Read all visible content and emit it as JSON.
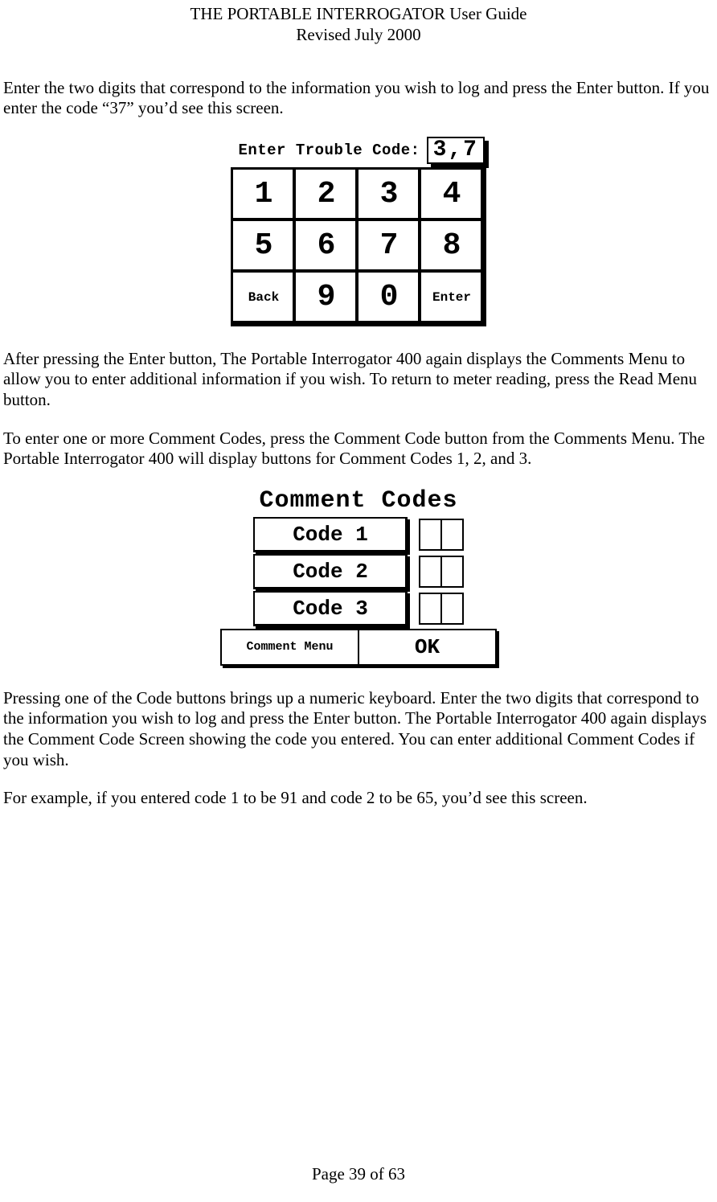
{
  "header": {
    "title": "THE PORTABLE INTERROGATOR User Guide",
    "revised": "Revised July 2000"
  },
  "paragraphs": {
    "p1": "Enter the two digits that correspond to the information you wish to log and press the Enter button.  If you enter the code “37” you’d see this screen.",
    "p2": "After pressing the Enter button, The Portable Interrogator 400 again displays the Comments Menu to allow you to enter additional information if you wish.  To return to meter reading, press the Read Menu button.",
    "p3": "To enter one or more Comment Codes, press the Comment Code button from the Comments Menu.  The Portable Interrogator 400 will display buttons for Comment Codes 1, 2, and 3.",
    "p4": "Pressing one of the Code buttons brings up a numeric keyboard.  Enter the two digits that correspond to the information you wish to log and press the Enter button.  The Portable Interrogator 400 again displays the Comment Code Screen showing the code you entered.  You can enter additional Comment Codes if you wish.",
    "p5": "For example, if you entered code 1 to be 91 and code 2 to be 65, you’d see this screen."
  },
  "keypad": {
    "prompt": "Enter Trouble Code:",
    "value": "3,7",
    "keys": {
      "k1": "1",
      "k2": "2",
      "k3": "3",
      "k4": "4",
      "k5": "5",
      "k6": "6",
      "k7": "7",
      "k8": "8",
      "back": "Back",
      "k9": "9",
      "k0": "0",
      "enter": "Enter"
    }
  },
  "comment_codes": {
    "title": "Comment Codes",
    "rows": [
      {
        "label": "Code 1"
      },
      {
        "label": "Code 2"
      },
      {
        "label": "Code 3"
      }
    ],
    "menu_label": "Comment Menu",
    "ok_label": "OK"
  },
  "footer": {
    "page": "Page 39 of 63"
  }
}
